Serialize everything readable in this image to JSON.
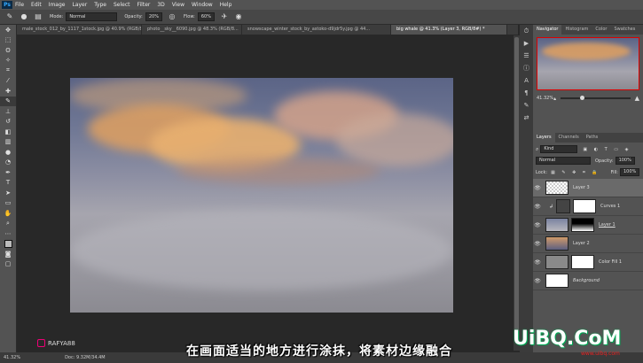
{
  "menubar": {
    "logo": "Ps",
    "items": [
      "File",
      "Edit",
      "Image",
      "Layer",
      "Type",
      "Select",
      "Filter",
      "3D",
      "View",
      "Window",
      "Help"
    ]
  },
  "options": {
    "mode_label": "Mode:",
    "mode_value": "Normal",
    "opacity_label": "Opacity:",
    "opacity_value": "20%",
    "flow_label": "Flow:",
    "flow_value": "60%"
  },
  "doc_tabs": [
    {
      "label": "male_stock_012_by_1117_1stock.jpg @ 40.9% (RGB/8...",
      "active": false
    },
    {
      "label": "photo__sky__6090.jpg @ 48.3% (RGB/8...",
      "active": false
    },
    {
      "label": "snowscape_winter_stock_by_astoko-d9jdr5y.jpg @ 44...",
      "active": false
    },
    {
      "label": "big whale @ 41.3% (Layer 3, RGB/8#) *",
      "active": true
    }
  ],
  "panel": {
    "top_tabs": [
      "Navigator",
      "Histogram",
      "Color",
      "Swatches"
    ],
    "zoom": "41.32%",
    "layer_tabs": [
      "Layers",
      "Channels",
      "Paths"
    ],
    "kind": "Kind",
    "blend": "Normal",
    "opacity_label": "Opacity:",
    "opacity_value": "100%",
    "lock_label": "Lock:",
    "fill_label": "Fill:",
    "fill_value": "100%",
    "layers": [
      {
        "name": "Layer 3",
        "selected": true
      },
      {
        "name": "Curves 1",
        "selected": false
      },
      {
        "name": "Layer 1",
        "selected": false
      },
      {
        "name": "Layer 2",
        "selected": false
      },
      {
        "name": "Color Fill 1",
        "selected": false
      },
      {
        "name": "Background",
        "selected": false
      }
    ]
  },
  "status": {
    "zoom": "41.32%",
    "doc": "Doc: 9.32M/34.4M"
  },
  "overlay": {
    "subtitle": "在画面适当的地方进行涂抹，将素材边缘融合",
    "instagram": "RAFYA88",
    "watermark": "UiBQ.CoM",
    "watermark_sub": "www.uibq.com"
  }
}
